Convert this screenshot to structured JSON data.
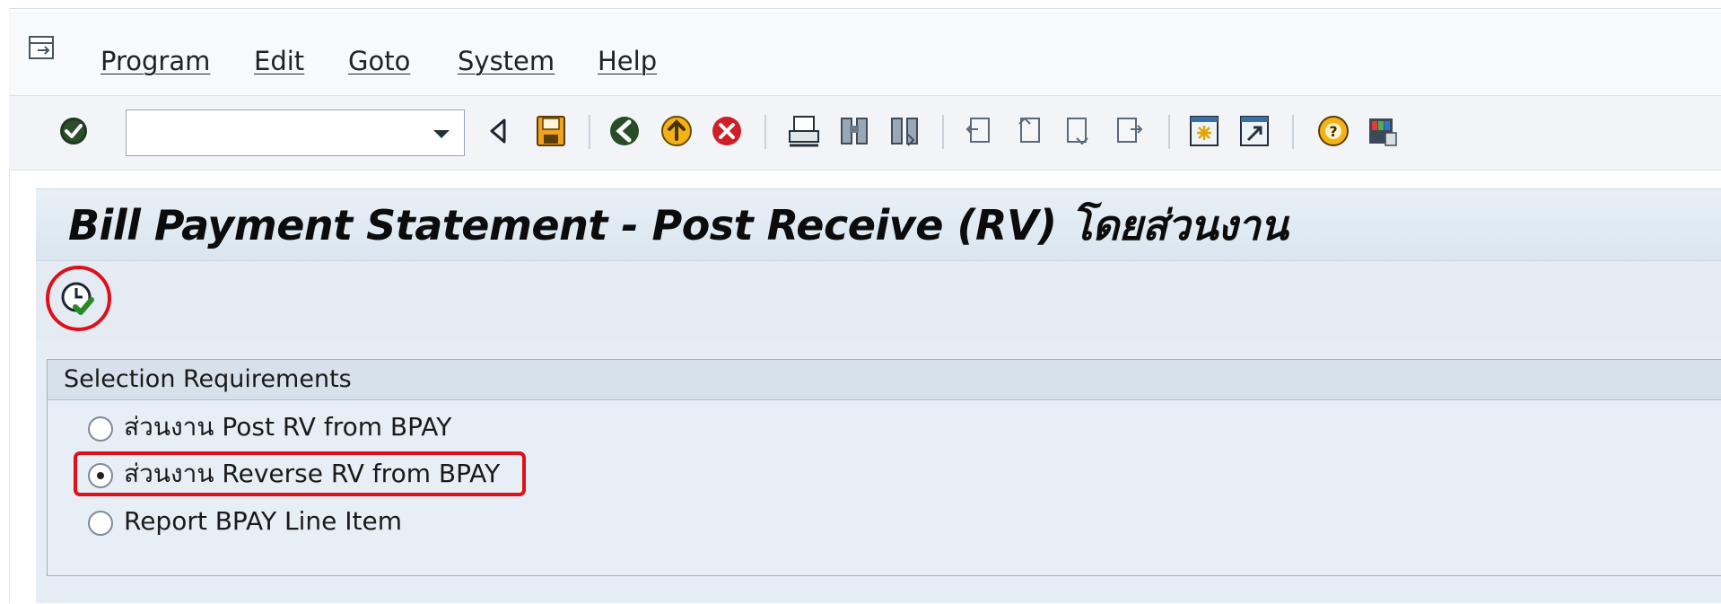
{
  "menu": {
    "items": [
      {
        "label": "Program",
        "icon": "menu-entry-icon"
      },
      {
        "label": "Edit"
      },
      {
        "label": "Goto"
      },
      {
        "label": "System"
      },
      {
        "label": "Help"
      }
    ]
  },
  "toolbar": {
    "command_field_value": "",
    "buttons": [
      "enter-icon",
      "back-triangle-icon",
      "save-icon",
      "back-icon",
      "exit-icon",
      "cancel-icon",
      "print-icon",
      "find-icon",
      "find-next-icon",
      "first-page-icon",
      "previous-page-icon",
      "next-page-icon",
      "last-page-icon",
      "new-session-icon",
      "create-shortcut-icon",
      "help-icon",
      "customize-layout-icon"
    ]
  },
  "title": "Bill Payment Statement - Post Receive (RV) โดยส่วนงาน",
  "app_toolbar": {
    "execute_icon": "execute-icon"
  },
  "selection": {
    "group_title": "Selection Requirements",
    "options": [
      {
        "label": "ส่วนงาน Post RV from BPAY",
        "selected": false
      },
      {
        "label": "ส่วนงาน Reverse RV from BPAY",
        "selected": true
      },
      {
        "label": "Report BPAY Line Item",
        "selected": false
      }
    ]
  },
  "colors": {
    "highlight": "#e0101a",
    "title_bg": "#dce7f0",
    "content_bg": "#e7eef5"
  }
}
